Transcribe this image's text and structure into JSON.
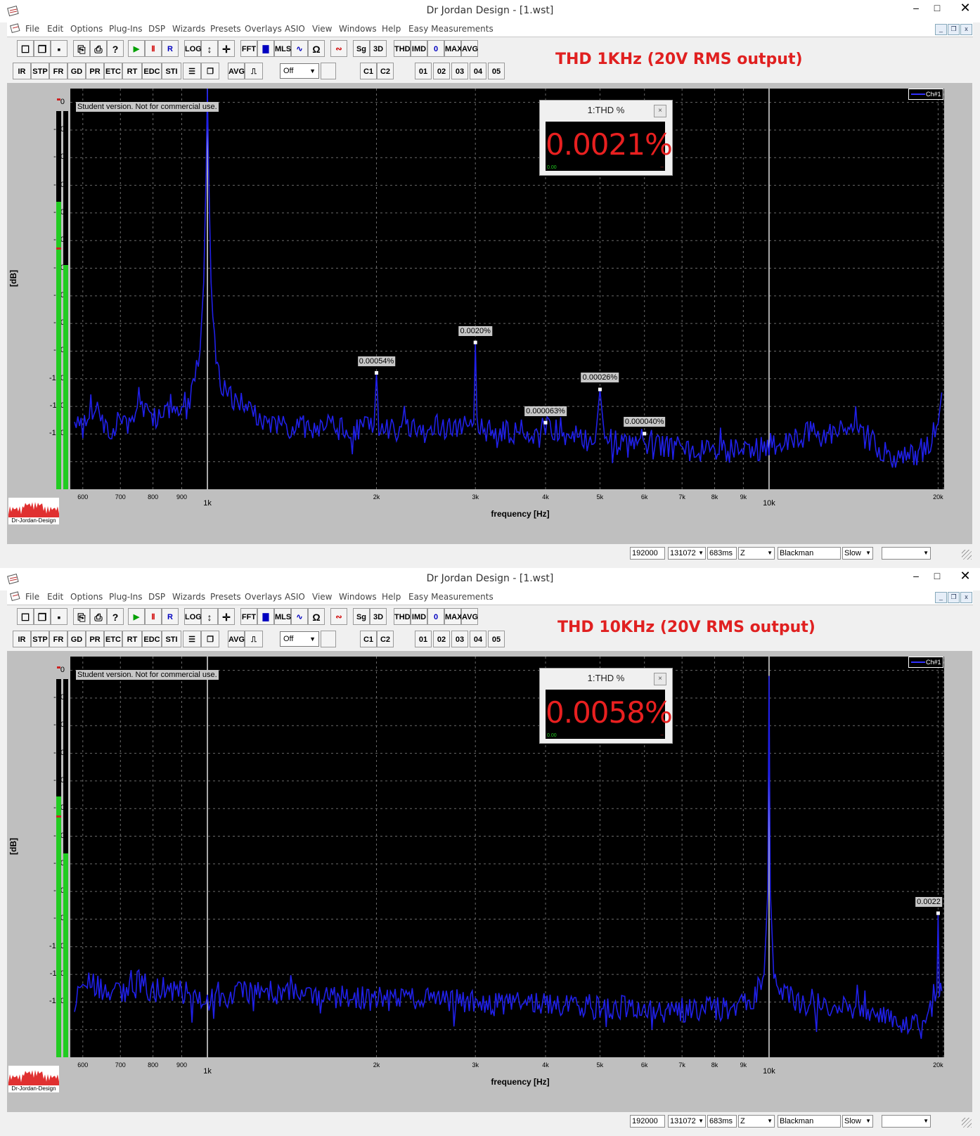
{
  "windows": [
    {
      "title": "Dr Jordan Design - [1.wst]",
      "annotation": "THD 1KHz (20V RMS output)",
      "thd_panel": {
        "header": "1:THD %",
        "value": "0.0021%",
        "scale_min": "0.00",
        "scale_max": "--",
        "close": "×"
      },
      "meter": {
        "level": 0.76,
        "peak": 0.36
      },
      "harmonic_labels": [
        {
          "text": "0.00054%",
          "freq": 2000,
          "db": -98
        },
        {
          "text": "0.0020%",
          "freq": 3000,
          "db": -87
        },
        {
          "text": "0.000063%",
          "freq": 4000,
          "db": -116
        },
        {
          "text": "0.00026%",
          "freq": 5000,
          "db": -104
        },
        {
          "text": "0.000040%",
          "freq": 6000,
          "db": -120
        }
      ]
    },
    {
      "title": "Dr Jordan Design - [1.wst]",
      "annotation": "THD 10KHz (20V RMS output)",
      "thd_panel": {
        "header": "1:THD %",
        "value": "0.0058%",
        "scale_min": "0.00",
        "scale_max": "--",
        "close": "×"
      },
      "meter": {
        "level": 0.69,
        "peak": 0.36
      },
      "harmonic_labels": [
        {
          "text": "0.0022",
          "freq": 20000,
          "db": -88
        }
      ]
    }
  ],
  "window_controls": {
    "minimize": "–",
    "maximize": "□",
    "close": "✕"
  },
  "mdi_controls": {
    "minimize": "_",
    "restore": "❐",
    "close": "x"
  },
  "menu": [
    "File",
    "Edit",
    "Options",
    "Plug-Ins",
    "DSP",
    "Wizards",
    "Presets",
    "Overlays",
    "ASIO",
    "View",
    "Windows",
    "Help",
    "Easy Measurements"
  ],
  "toolbar1": [
    {
      "label": "☐",
      "name": "new-file-button",
      "style": "icon"
    },
    {
      "label": "❐",
      "name": "open-file-button",
      "style": "icon"
    },
    {
      "label": "▪",
      "name": "save-button",
      "style": "icon"
    },
    {
      "label": "⎘",
      "name": "copy-button",
      "style": "icon"
    },
    {
      "label": "⎙",
      "name": "print-button",
      "style": "icon"
    },
    {
      "label": "?",
      "name": "help-button",
      "style": "icon"
    },
    {
      "label": "▶",
      "name": "play-button",
      "style": "green"
    },
    {
      "label": "Ⅱ",
      "name": "pause-button",
      "style": "red"
    },
    {
      "label": "R",
      "name": "record-button",
      "style": "blue"
    },
    {
      "label": "LOG",
      "name": "log-button",
      "style": ""
    },
    {
      "label": "↕",
      "name": "vertical-zoom-button",
      "style": "icon"
    },
    {
      "label": "✛",
      "name": "pan-button",
      "style": "icon"
    },
    {
      "label": "FFT",
      "name": "fft-button",
      "style": ""
    },
    {
      "label": "▇",
      "name": "spectrum-button",
      "style": "blue"
    },
    {
      "label": "MLS",
      "name": "mls-button",
      "style": ""
    },
    {
      "label": "∿",
      "name": "wave-button",
      "style": "blue"
    },
    {
      "label": "Ω",
      "name": "impedance-button",
      "style": "icon"
    },
    {
      "label": "∾",
      "name": "overlay-button",
      "style": "red"
    },
    {
      "label": "Sg",
      "name": "signal-generator-button",
      "style": ""
    },
    {
      "label": "3D",
      "name": "3d-button",
      "style": ""
    },
    {
      "label": "THD",
      "name": "thd-button",
      "style": ""
    },
    {
      "label": "IMD",
      "name": "imd-button",
      "style": ""
    },
    {
      "label": "0",
      "name": "zero-button",
      "style": "blue"
    },
    {
      "label": "MAX",
      "name": "max-button",
      "style": ""
    },
    {
      "label": "AVG",
      "name": "avg-toolbar-button",
      "style": ""
    }
  ],
  "toolbar2": [
    {
      "label": "IR",
      "name": "ir-button"
    },
    {
      "label": "STP",
      "name": "stp-button"
    },
    {
      "label": "FR",
      "name": "fr-button"
    },
    {
      "label": "GD",
      "name": "gd-button"
    },
    {
      "label": "PR",
      "name": "pr-button"
    },
    {
      "label": "ETC",
      "name": "etc-button"
    },
    {
      "label": "RT",
      "name": "rt-button"
    },
    {
      "label": "EDC",
      "name": "edc-button"
    },
    {
      "label": "STI",
      "name": "sti-button"
    },
    {
      "label": "☰",
      "name": "list-button"
    },
    {
      "label": "❐",
      "name": "copy-view-button"
    },
    {
      "label": "AVG",
      "name": "avg-button"
    },
    {
      "label": "⎍",
      "name": "pulse-button"
    }
  ],
  "toolbar2_right": [
    {
      "label": "C1",
      "name": "channel-1-button"
    },
    {
      "label": "C2",
      "name": "channel-2-button"
    },
    {
      "label": "01",
      "name": "memory-01-button"
    },
    {
      "label": "02",
      "name": "memory-02-button"
    },
    {
      "label": "03",
      "name": "memory-03-button"
    },
    {
      "label": "04",
      "name": "memory-04-button"
    },
    {
      "label": "05",
      "name": "memory-05-button"
    }
  ],
  "off_combo": "Off",
  "student_notice": "Student version. Not for commercial use.",
  "channel_legend": "Ch#1",
  "logo_text": "Dr-Jordan-Design",
  "chart_data": {
    "type": "line",
    "xlabel": "frequency [Hz]",
    "ylabel": "[dB]",
    "xscale": "log",
    "xlim": [
      570,
      20500
    ],
    "ylim": [
      -140,
      5
    ],
    "yticks": [
      "0",
      "-10",
      "-20",
      "-30",
      "-40",
      "-50",
      "-60",
      "-70",
      "-80",
      "-90",
      "-100",
      "-110",
      "-120"
    ],
    "xticks": [
      {
        "v": 600,
        "t": "600"
      },
      {
        "v": 700,
        "t": "700"
      },
      {
        "v": 800,
        "t": "800"
      },
      {
        "v": 900,
        "t": "900"
      },
      {
        "v": 1000,
        "t": "1k",
        "major": true
      },
      {
        "v": 2000,
        "t": "2k"
      },
      {
        "v": 3000,
        "t": "3k"
      },
      {
        "v": 4000,
        "t": "4k"
      },
      {
        "v": 5000,
        "t": "5k"
      },
      {
        "v": 6000,
        "t": "6k"
      },
      {
        "v": 7000,
        "t": "7k"
      },
      {
        "v": 8000,
        "t": "8k"
      },
      {
        "v": 9000,
        "t": "9k"
      },
      {
        "v": 10000,
        "t": "10k",
        "major": true
      },
      {
        "v": 20000,
        "t": "20k"
      }
    ],
    "series": [
      {
        "x": [
          580,
          600,
          620,
          650,
          680,
          700,
          730,
          760,
          800,
          830,
          860,
          900,
          930,
          950,
          970,
          985,
          995,
          1000,
          1005,
          1015,
          1030,
          1060,
          1100,
          1200,
          1400,
          1600,
          1800,
          1980,
          2000,
          2020,
          2200,
          2500,
          2800,
          2980,
          3000,
          3020,
          3300,
          3600,
          3900,
          4000,
          4100,
          4500,
          4900,
          5000,
          5100,
          5500,
          5900,
          6000,
          6100,
          6500,
          7000,
          7500,
          8000,
          8500,
          9000,
          9500,
          10000,
          11000,
          12000,
          13000,
          14000,
          15000,
          16000,
          17000,
          18000,
          19000,
          19500,
          20000,
          20300
        ],
        "y": [
          -112,
          -118,
          -110,
          -115,
          -120,
          -114,
          -117,
          -111,
          -115,
          -112,
          -109,
          -111,
          -106,
          -100,
          -90,
          -65,
          -25,
          5,
          -25,
          -65,
          -90,
          -101,
          -106,
          -113,
          -118,
          -117,
          -119,
          -117,
          -98,
          -117,
          -119,
          -117,
          -118,
          -116,
          -87,
          -117,
          -120,
          -119,
          -121,
          -116,
          -121,
          -121,
          -123,
          -104,
          -122,
          -124,
          -125,
          -120,
          -125,
          -124,
          -126,
          -126,
          -126,
          -126,
          -125,
          -126,
          -124,
          -122,
          -119,
          -119,
          -120,
          -121,
          -128,
          -129,
          -128,
          -125,
          -121,
          -116,
          -105
        ]
      },
      {
        "x": [
          580,
          600,
          650,
          700,
          750,
          800,
          850,
          900,
          950,
          1000,
          1100,
          1200,
          1500,
          2000,
          2500,
          3000,
          3500,
          4000,
          4500,
          5000,
          5500,
          6000,
          6500,
          7000,
          7500,
          8000,
          8500,
          9000,
          9500,
          9800,
          9950,
          10000,
          10050,
          10200,
          10500,
          11000,
          12000,
          13000,
          14000,
          15000,
          16000,
          17000,
          18000,
          19000,
          19500,
          19900,
          20000,
          20100,
          20300
        ],
        "y": [
          -120,
          -112,
          -115,
          -117,
          -112,
          -116,
          -114,
          -116,
          -118,
          -119,
          -118,
          -116,
          -118,
          -119,
          -118,
          -120,
          -121,
          -120,
          -121,
          -122,
          -122,
          -123,
          -123,
          -123,
          -123,
          -122,
          -123,
          -121,
          -117,
          -110,
          -80,
          -2,
          -80,
          -110,
          -115,
          -119,
          -121,
          -122,
          -123,
          -124,
          -126,
          -127,
          -128,
          -126,
          -123,
          -116,
          -88,
          -116,
          -116
        ]
      }
    ]
  },
  "statusbar": [
    {
      "text": "192000",
      "name": "sample-rate-field",
      "dd": false
    },
    {
      "text": "131072",
      "name": "fft-size-combo",
      "dd": true
    },
    {
      "text": "683ms",
      "name": "duration-field",
      "dd": false
    },
    {
      "text": "Z",
      "name": "weighting-combo",
      "dd": true
    },
    {
      "text": "Blackman",
      "name": "window-type-field",
      "dd": false
    },
    {
      "text": "Slow",
      "name": "averaging-combo",
      "dd": true
    },
    {
      "text": "",
      "name": "extra-combo",
      "dd": true
    }
  ]
}
